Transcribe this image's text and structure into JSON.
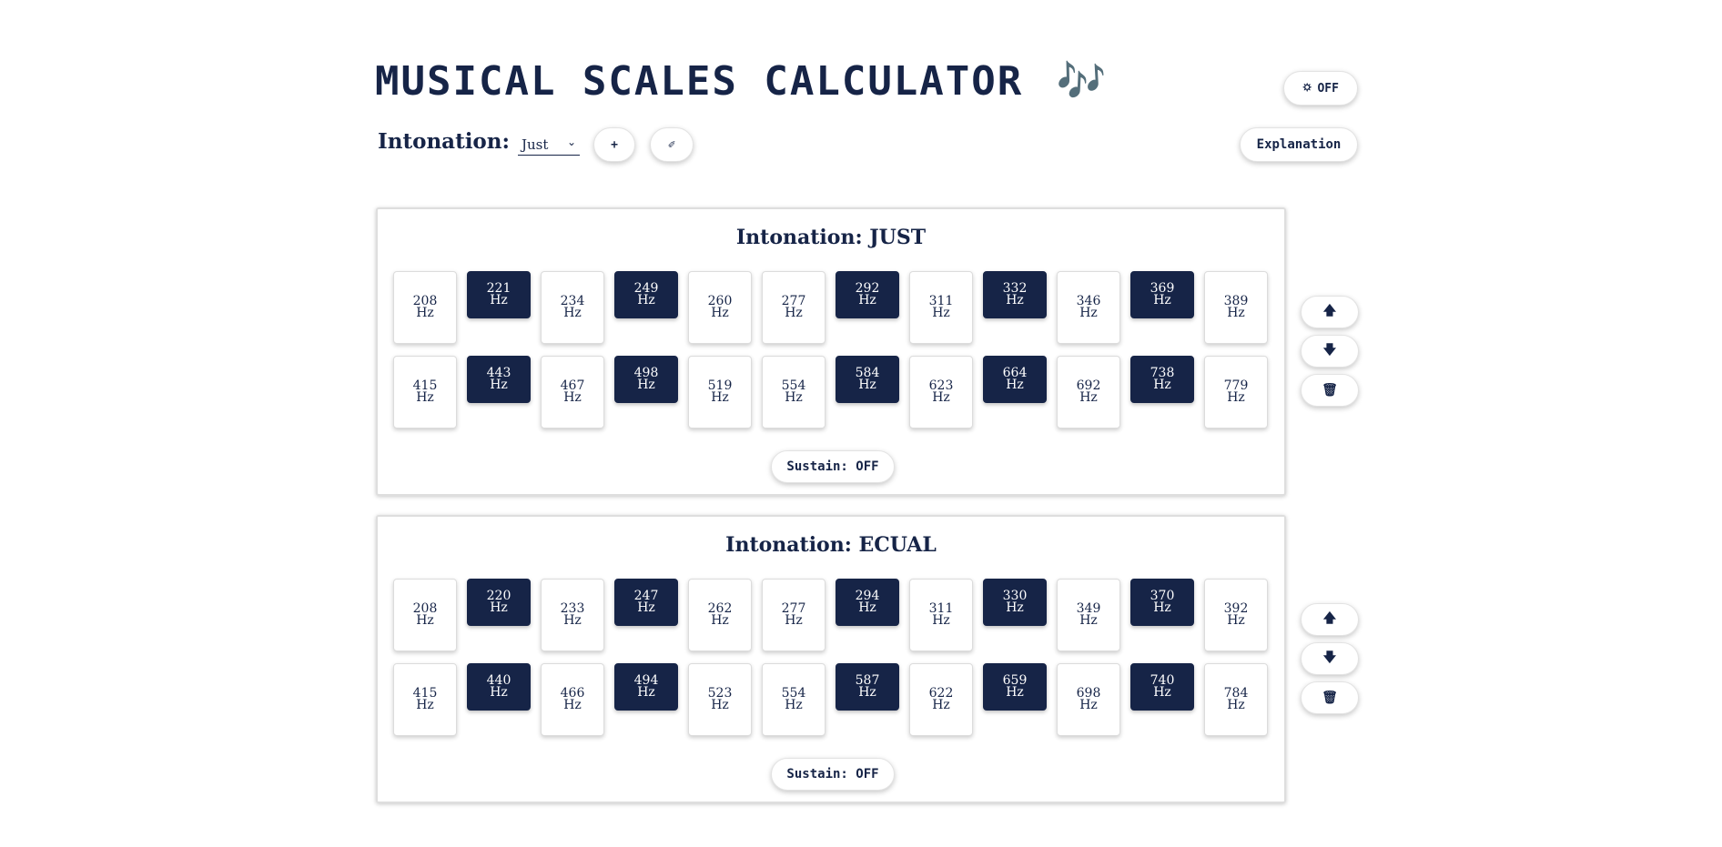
{
  "header": {
    "title": "MUSICAL SCALES CALCULATOR",
    "title_icon": "🎶",
    "dark_mode_icon": "🌣",
    "dark_mode_label": "OFF"
  },
  "controls": {
    "intonation_label": "Intonation:",
    "intonation_selected": "Just",
    "chevron": "⌄",
    "add_label": "+",
    "tool_icon": "✐",
    "explanation_label": "Explanation"
  },
  "panels": [
    {
      "title": "Intonation: JUST",
      "row1": [
        "208",
        "221",
        "234",
        "249",
        "260",
        "277",
        "292",
        "311",
        "332",
        "346",
        "369",
        "389"
      ],
      "row2": [
        "415",
        "443",
        "467",
        "498",
        "519",
        "554",
        "584",
        "623",
        "664",
        "692",
        "738",
        "779"
      ],
      "unit": "Hz",
      "sustain_label": "Sustain: OFF",
      "up_icon": "🡅",
      "down_icon": "🡇",
      "delete_icon": "🗑"
    },
    {
      "title": "Intonation: ECUAL",
      "row1": [
        "208",
        "220",
        "233",
        "247",
        "262",
        "277",
        "294",
        "311",
        "330",
        "349",
        "370",
        "392"
      ],
      "row2": [
        "415",
        "440",
        "466",
        "494",
        "523",
        "554",
        "587",
        "622",
        "659",
        "698",
        "740",
        "784"
      ],
      "unit": "Hz",
      "sustain_label": "Sustain: OFF",
      "up_icon": "🡅",
      "down_icon": "🡇",
      "delete_icon": "🗑"
    }
  ],
  "colors": {
    "navy": "#162447",
    "white_key": "#ffffff"
  }
}
